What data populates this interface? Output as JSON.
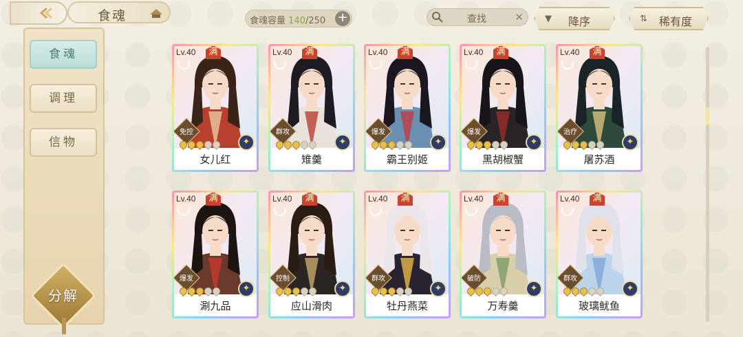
{
  "header": {
    "title": "食魂",
    "capacity_label": "食魂容量",
    "capacity_current": "140",
    "capacity_total": "/250",
    "capacity_add": "+",
    "search_placeholder": "查找",
    "search_clear": "✕",
    "sort_desc_label": "降序",
    "sort_rarity_label": "稀有度"
  },
  "sidebar": {
    "items": [
      {
        "label": "食魂",
        "active": true
      },
      {
        "label": "调理",
        "active": false
      },
      {
        "label": "信物",
        "active": false
      }
    ],
    "decompose_label": "分解"
  },
  "cards": [
    {
      "level": "Lv.40",
      "max": "满",
      "role": "免控",
      "name": "女儿红",
      "stars": 3,
      "hair": "#3a2418",
      "robe": "#b8402f",
      "accent": "#e8c9a0"
    },
    {
      "level": "Lv.40",
      "max": "满",
      "role": "群攻",
      "name": "雉羹",
      "stars": 3,
      "hair": "#1e1b22",
      "robe": "#e9e2dc",
      "accent": "#b8402f"
    },
    {
      "level": "Lv.40",
      "max": "满",
      "role": "爆发",
      "name": "霸王别姬",
      "stars": 3,
      "hair": "#1b1720",
      "robe": "#6a8fb0",
      "accent": "#c03a46"
    },
    {
      "level": "Lv.40",
      "max": "满",
      "role": "爆发",
      "name": "黑胡椒蟹",
      "stars": 3,
      "hair": "#17141a",
      "robe": "#2a2426",
      "accent": "#9e2b2b"
    },
    {
      "level": "Lv.40",
      "max": "满",
      "role": "治疗",
      "name": "屠苏酒",
      "stars": 3,
      "hair": "#1a2326",
      "robe": "#2d4a3c",
      "accent": "#d8c07a"
    },
    {
      "level": "Lv.40",
      "max": "满",
      "role": "爆发",
      "name": "涮九品",
      "stars": 3,
      "hair": "#1d1512",
      "robe": "#6c3a2c",
      "accent": "#c9392f"
    },
    {
      "level": "Lv.40",
      "max": "满",
      "role": "控制",
      "name": "应山滑肉",
      "stars": 3,
      "hair": "#2a1d14",
      "robe": "#2b2624",
      "accent": "#caa86a"
    },
    {
      "level": "Lv.40",
      "max": "满",
      "role": "群攻",
      "name": "牡丹燕菜",
      "stars": 3,
      "hair": "#eae6ea",
      "robe": "#2a2430",
      "accent": "#e8b84a"
    },
    {
      "level": "Lv.40",
      "max": "满",
      "role": "破防",
      "name": "万寿羹",
      "stars": 3,
      "hair": "#b9bcc4",
      "robe": "#d8cfa8",
      "accent": "#7e9a6a"
    },
    {
      "level": "Lv.40",
      "max": "满",
      "role": "群攻",
      "name": "玻璃鱿鱼",
      "stars": 3,
      "hair": "#dfe2ea",
      "robe": "#bcd3ec",
      "accent": "#7fa6d6"
    }
  ]
}
